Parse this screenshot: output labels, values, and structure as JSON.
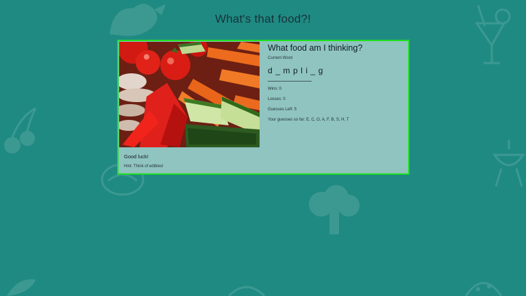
{
  "app": {
    "title": "What's that food?!"
  },
  "game": {
    "question": "What food am I thinking?",
    "current_word_label": "Current Word",
    "current_word": "d _ m p l i _ g",
    "wins": "Wins: 0",
    "losses": "Losses: 0",
    "guesses_left": "Guesses Left: 5",
    "guesses_so_far": "Your guesses so far: E, C, O, A, F, B, S, H, T",
    "good_luck": "Good luck!",
    "hint": "Hint: Think of edibles!"
  },
  "colors": {
    "background": "#1f8a82",
    "card": "#8fc4c1",
    "card_border": "#1fe01f"
  },
  "image": {
    "subject": "vegetables-photo"
  }
}
